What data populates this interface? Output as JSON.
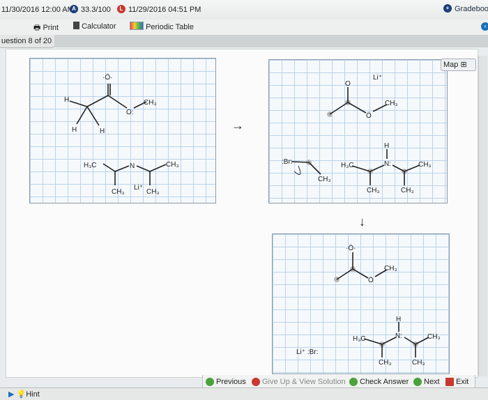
{
  "header": {
    "due_date": "11/30/2016 12:00 AM",
    "score": "33.3/100",
    "late_date": "11/29/2016 04:51 PM",
    "gradebook": "Gradeboo"
  },
  "toolbar": {
    "print": "Print",
    "calculator": "Calculator",
    "periodic_table": "Periodic Table"
  },
  "question_tab": "uestion 8 of 20",
  "map_button": "Map",
  "arrows": {
    "right": "→",
    "down": "↓"
  },
  "panel1": {
    "o_top": "·Ö·",
    "h1": "H",
    "h2": "H",
    "h3": "H",
    "o_ester": "O:",
    "ch3_a": "CH₃",
    "h3c": "H₃C",
    "n": "N",
    "ch3_b": "CH₃",
    "ch3_c": "CH₃",
    "li": "Li⁺",
    "ch3_d": "CH₃"
  },
  "panel2": {
    "o_top": "O",
    "li": "Li⁺",
    "o_ester": "Ö",
    "ch3_a": "CH₃",
    "br": ":Br:",
    "ch3_br": "CH₃",
    "h3c": "H₃C",
    "n": "N:",
    "h": "H",
    "ch3_b": "CH₃",
    "ch3_c": "CH₃",
    "ch3_d": "CH₃"
  },
  "panel3": {
    "o_top": "·Ö·",
    "o_ester": "Ö",
    "ch3_a": "CH₃",
    "li_br": "Li⁺ :Br:",
    "h3c": "H₃C",
    "n": "N:",
    "h": "H",
    "ch3_b": "CH₃",
    "ch3_c": "CH₃",
    "ch3_d": "CH₃"
  },
  "footer": {
    "previous": "Previous",
    "give_up": "Give Up & View Solution",
    "check": "Check Answer",
    "next": "Next",
    "exit": "Exit",
    "hint": "Hint"
  },
  "colors": {
    "green": "#4aa23c",
    "red": "#c8382e",
    "blue": "#1d3f7a"
  }
}
